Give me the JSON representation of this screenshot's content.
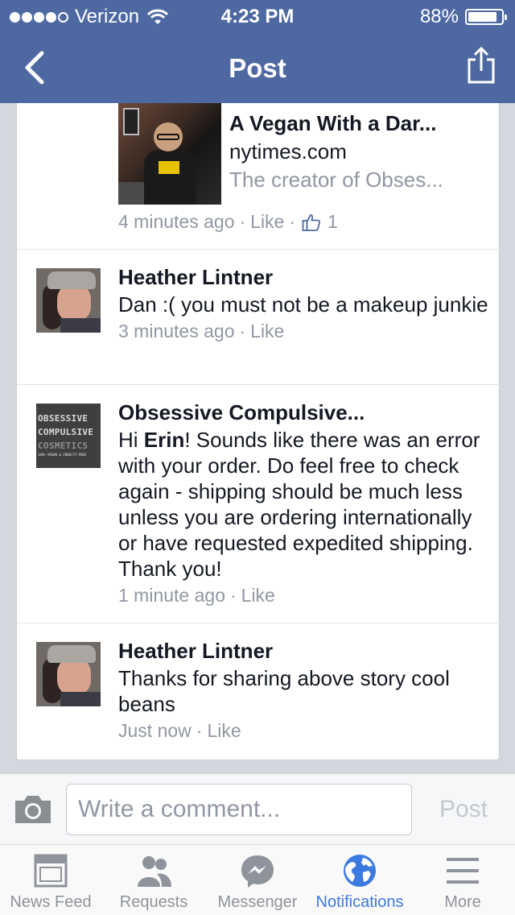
{
  "status_bar": {
    "carrier": "Verizon",
    "time": "4:23 PM",
    "battery": "88%",
    "battery_level": 0.88
  },
  "nav": {
    "title": "Post"
  },
  "link_preview": {
    "title": "A Vegan With a Dar...",
    "domain": "nytimes.com",
    "description": "The creator of Obses...",
    "time": "4 minutes ago",
    "like_label": "Like",
    "like_count": "1"
  },
  "comments": [
    {
      "author": "Heather Lintner",
      "text": "Dan :( you must not be a makeup junkie",
      "time": "3 minutes ago",
      "like_label": "Like"
    },
    {
      "author": "Obsessive Compulsive...",
      "text_prefix": "Hi ",
      "mention": "Erin",
      "text_suffix": "! Sounds like there was an error with your order. Do feel free to check again - shipping should be much less unless you are ordering internationally or have requested expedited shipping. Thank you!",
      "time": "1 minute ago",
      "like_label": "Like",
      "avatar_text": [
        "OBSESSIVE",
        "COMPULSIVE",
        "COSMETICS",
        "100% VEGAN & CRUELTY-FREE"
      ]
    },
    {
      "author": "Heather Lintner",
      "text": "Thanks for sharing above story cool beans",
      "time": "Just now",
      "like_label": "Like"
    }
  ],
  "composer": {
    "placeholder": "Write a comment...",
    "post_label": "Post"
  },
  "tabs": [
    {
      "label": "News Feed",
      "icon": "news-feed-icon"
    },
    {
      "label": "Requests",
      "icon": "friend-requests-icon"
    },
    {
      "label": "Messenger",
      "icon": "messenger-icon"
    },
    {
      "label": "Notifications",
      "icon": "globe-icon",
      "active": true
    },
    {
      "label": "More",
      "icon": "menu-icon"
    }
  ],
  "colors": {
    "header": "#4e69a2",
    "active_tab": "#3c7ae0",
    "meta_text": "#9197a3"
  }
}
